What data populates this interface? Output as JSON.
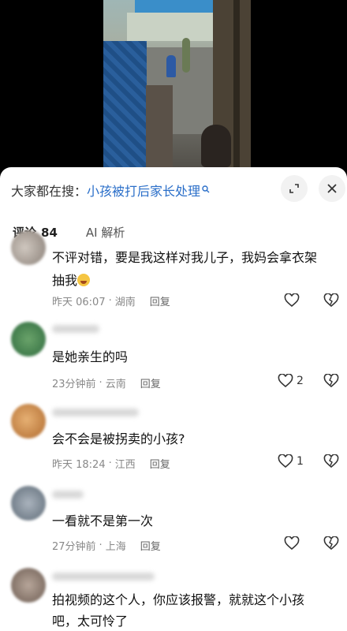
{
  "search": {
    "prefix": "大家都在搜：",
    "query": "小孩被打后家长处理",
    "suffix_icon": "search-icon"
  },
  "header_buttons": {
    "expand_icon": "expand-icon",
    "close_icon": "close-icon"
  },
  "tabs": [
    {
      "label": "评论",
      "count": "84",
      "active": true
    },
    {
      "label": "AI 解析",
      "active": false
    }
  ],
  "comments": [
    {
      "text_line1": "不评对错，要是我这样对我儿子，我妈会拿衣架",
      "text_line2": "抽我",
      "emoji": "crying-laugh-emoji",
      "time": "昨天 06:07",
      "location": "湖南",
      "reply": "回复",
      "likes": ""
    },
    {
      "text_line1": "是她亲生的吗",
      "time": "23分钟前",
      "location": "云南",
      "reply": "回复",
      "likes": "2"
    },
    {
      "text_line1": "会不会是被拐卖的小孩?",
      "time": "昨天 18:24",
      "location": "江西",
      "reply": "回复",
      "likes": "1"
    },
    {
      "text_line1": "一看就不是第一次",
      "time": "27分钟前",
      "location": "上海",
      "reply": "回复",
      "likes": ""
    },
    {
      "text_line1": "拍视频的这个人，你应该报警，就就这个小孩",
      "text_line2": "吧，太可怜了"
    }
  ],
  "colors": {
    "link": "#2b6fc9",
    "meta": "#888888",
    "sheet_bg": "#ffffff"
  }
}
